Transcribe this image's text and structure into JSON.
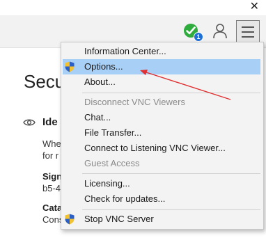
{
  "window": {
    "close_glyph": "✕"
  },
  "toolbar": {
    "status_icon": "check-circle-icon",
    "status_color": "#2eac3c",
    "badge_count": "1",
    "badge_color": "#1e6fd6",
    "user_icon": "user-icon",
    "menu_icon": "hamburger-menu-icon"
  },
  "main": {
    "page_title": "Secu",
    "section_title": "Ide",
    "body_lines": [
      "Whe",
      "for r"
    ],
    "signature_label": "Sign",
    "signature_value": "b5-4",
    "catalog_label": "Cata",
    "catalog_value": "Cons"
  },
  "menu": {
    "highlight_color": "#a8cff6",
    "items": [
      {
        "label": "Information Center...",
        "enabled": true,
        "icon": ""
      },
      {
        "label": "Options...",
        "enabled": true,
        "icon": "uac-shield-icon",
        "highlighted": true
      },
      {
        "label": "About...",
        "enabled": true,
        "icon": ""
      },
      {
        "label": "Disconnect VNC Viewers",
        "enabled": false,
        "icon": ""
      },
      {
        "label": "Chat...",
        "enabled": true,
        "icon": ""
      },
      {
        "label": "File Transfer...",
        "enabled": true,
        "icon": ""
      },
      {
        "label": "Connect to Listening VNC Viewer...",
        "enabled": true,
        "icon": ""
      },
      {
        "label": "Guest Access",
        "enabled": false,
        "icon": ""
      },
      {
        "label": "Licensing...",
        "enabled": true,
        "icon": ""
      },
      {
        "label": "Check for updates...",
        "enabled": true,
        "icon": ""
      },
      {
        "label": "Stop VNC Server",
        "enabled": true,
        "icon": "uac-shield-icon"
      }
    ]
  },
  "annotation": {
    "arrow_color": "#e03030"
  }
}
